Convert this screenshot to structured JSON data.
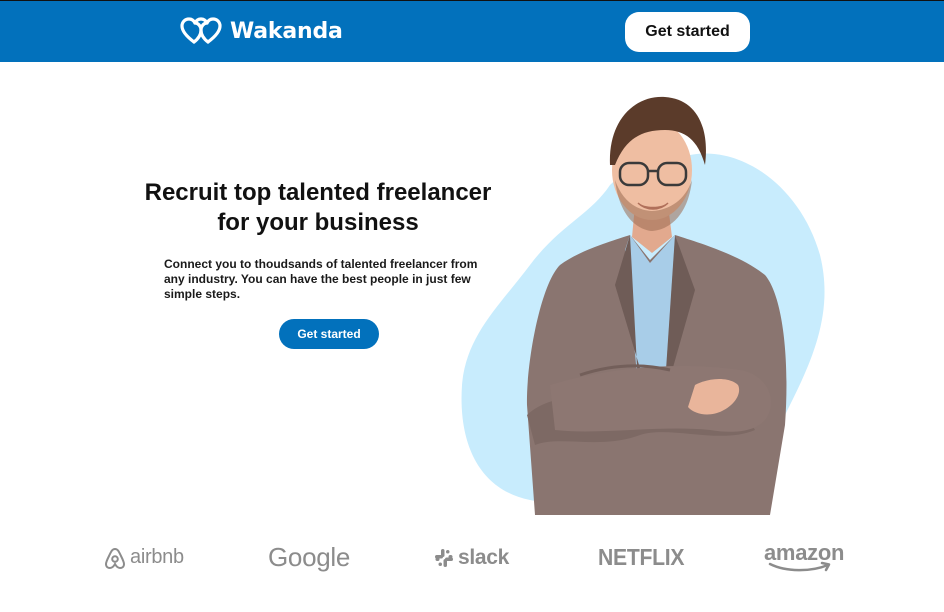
{
  "header": {
    "brand_name": "Wakanda",
    "cta_label": "Get started",
    "background_color": "#0271bc",
    "logo_icon": "double-heart-icon"
  },
  "hero": {
    "title": "Recruit top talented freelancer for your business",
    "subtitle": "Connect you to thoudsands of talented freelancer from any industry. You can have the best people in just few simple steps.",
    "cta_label": "Get started",
    "image": "smiling-man-in-plaid-blazer-arms-crossed",
    "blob_color": "#c8ecfd"
  },
  "partners": [
    {
      "name": "airbnb",
      "icon": "airbnb-icon"
    },
    {
      "name": "Google",
      "icon": null
    },
    {
      "name": "slack",
      "icon": "slack-icon"
    },
    {
      "name": "NETFLIX",
      "icon": null
    },
    {
      "name": "amazon",
      "icon": "amazon-smile-icon"
    }
  ],
  "colors": {
    "primary": "#0271bc",
    "partner_logo_gray": "#8c8c8c"
  }
}
